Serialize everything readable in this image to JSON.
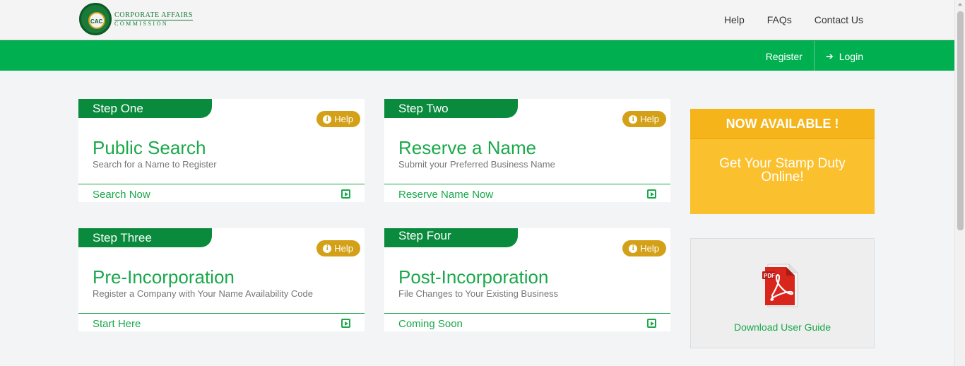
{
  "brand": {
    "seal_text": "CAC",
    "name_line1": "CORPORATE AFFAIRS",
    "name_line2": "COMMISSION"
  },
  "topnav": {
    "help": "Help",
    "faqs": "FAQs",
    "contact": "Contact Us"
  },
  "mainnav": {
    "register": "Register",
    "login": "Login",
    "login_icon": "sign-in-icon"
  },
  "steps": [
    {
      "tab": "Step One",
      "help": "Help",
      "title": "Public Search",
      "subtitle": "Search for a Name to Register",
      "action": "Search Now"
    },
    {
      "tab": "Step Two",
      "help": "Help",
      "title": "Reserve a Name",
      "subtitle": "Submit your Preferred Business Name",
      "action": "Reserve Name Now"
    },
    {
      "tab": "Step Three",
      "help": "Help",
      "title": "Pre-Incorporation",
      "subtitle": "Register a Company with Your Name Availability Code",
      "action": "Start Here"
    },
    {
      "tab": "Step Four",
      "help": "Help",
      "title": "Post-Incorporation",
      "subtitle": "File Changes to Your Existing Business",
      "action": "Coming Soon"
    }
  ],
  "stamp": {
    "header": "NOW AVAILABLE !",
    "body_line1": "Get Your Stamp Duty",
    "body_line2": "Online!"
  },
  "guide": {
    "label": "Download User Guide",
    "icon": "pdf-file-icon"
  },
  "colors": {
    "brand_green": "#00b050",
    "dark_green": "#0a8a3c",
    "accent_gold": "#d4a017",
    "stamp_yellow": "#fbc02d"
  }
}
